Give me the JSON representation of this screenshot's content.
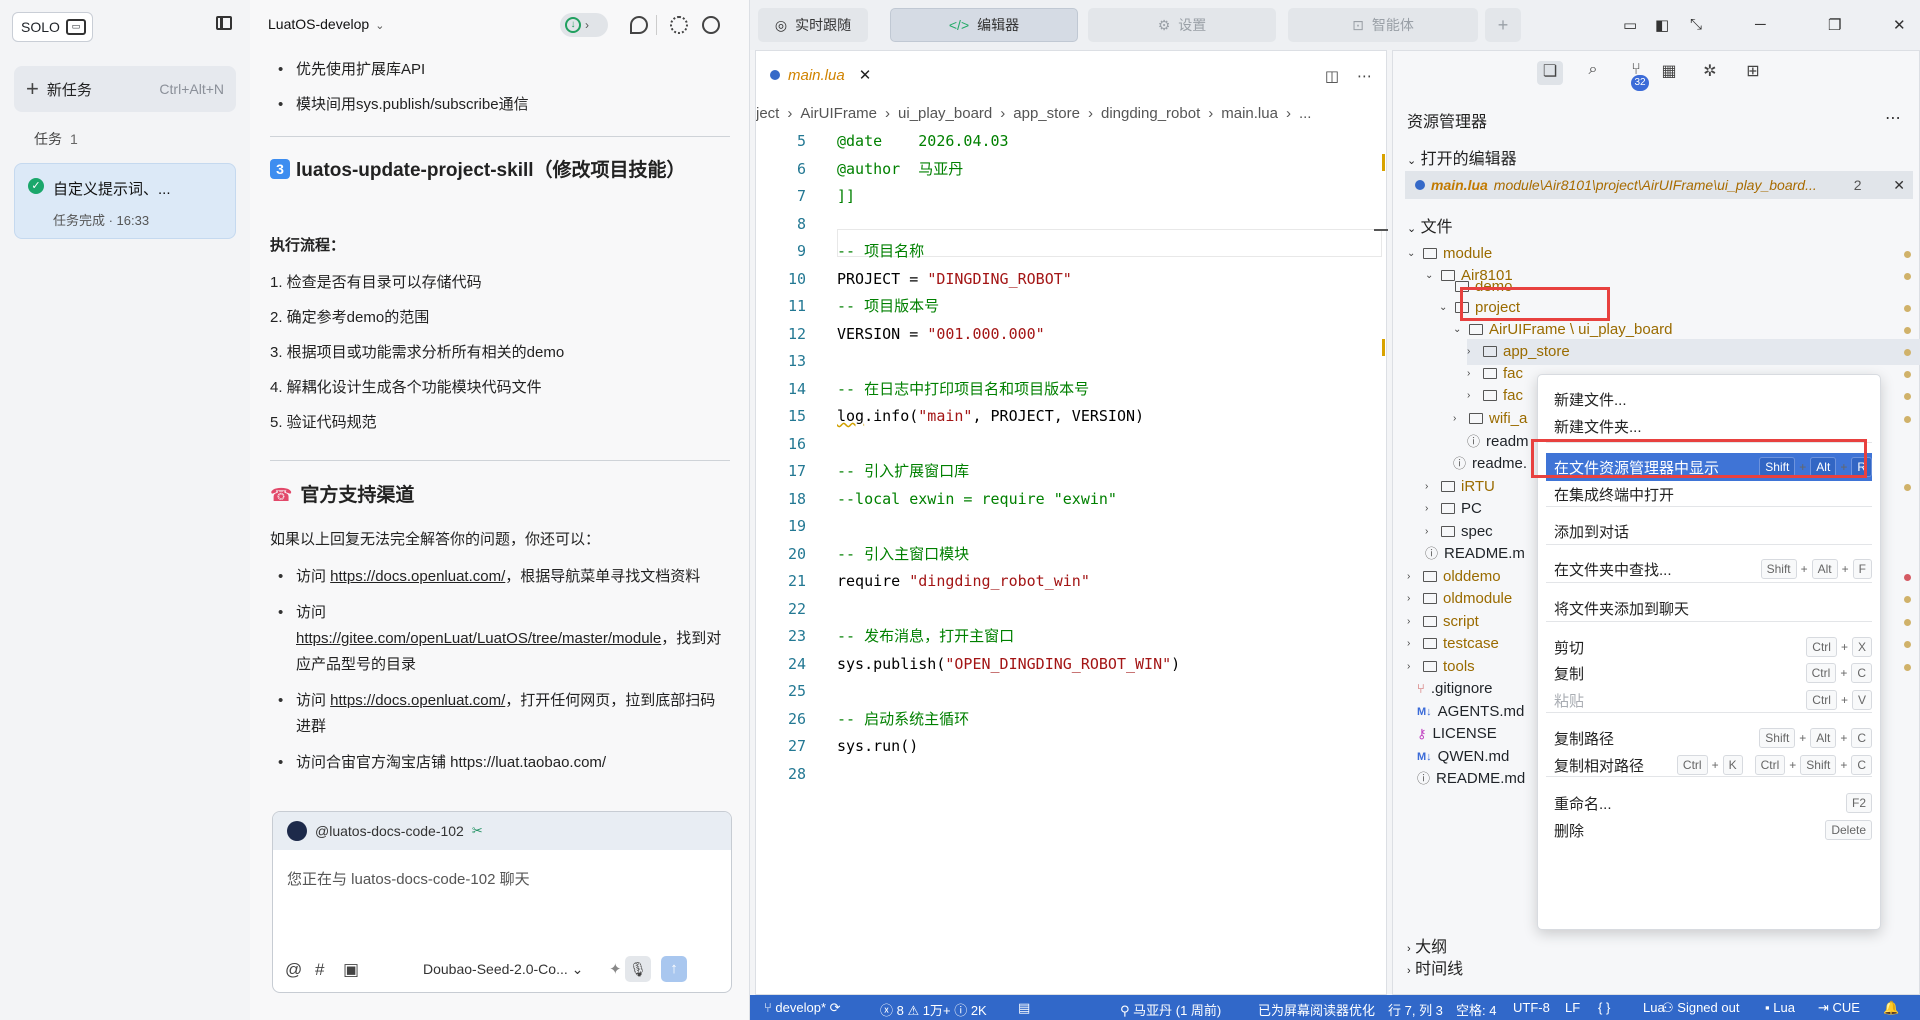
{
  "sidebar": {
    "solo": "SOLO",
    "new_task": "新任务",
    "new_task_kbd": "Ctrl+Alt+N",
    "tasks_label": "任务",
    "tasks_count": "1",
    "task_title": "自定义提示词、...",
    "task_status": "任务完成 · 16:33"
  },
  "chat": {
    "project": "LuatOS-develop",
    "bullets_top": [
      "优先使用扩展库API",
      "模块间用sys.publish/subscribe通信"
    ],
    "section3_num": "3",
    "section3_title": "luatos-update-project-skill（修改项目技能）",
    "flow_label": "执行流程：",
    "steps": [
      "1. 检查是否有目录可以存储代码",
      "2. 确定参考demo的范围",
      "3. 根据项目或功能需求分析所有相关的demo",
      "4. 解耦化设计生成各个功能模块代码文件",
      "5. 验证代码规范"
    ],
    "support_title": "官方支持渠道",
    "support_intro": "如果以上回复无法完全解答你的问题，你还可以：",
    "s1_pre": "访问 ",
    "s1_link": "https://docs.openluat.com/",
    "s1_post": "，根据导航菜单寻找文档资料",
    "s2_pre": "访问",
    "s2_link": "https://gitee.com/openLuat/LuatOS/tree/master/module",
    "s2_post": "，找到对应产品型号的目录",
    "s3_pre": "访问 ",
    "s3_link": "https://docs.openluat.com/",
    "s3_post": "，打开任何网页，拉到底部扫码进群",
    "s4": "访问合宙官方淘宝店铺 https://luat.taobao.com/",
    "mention": "@luatos-docs-code-102",
    "input_placeholder": "您正在与 luatos-docs-code-102 聊天",
    "model": "Doubao-Seed-2.0-Co..."
  },
  "top_tabs": {
    "t1": "实时跟随",
    "t2": "编辑器",
    "t3": "设置",
    "t4": "智能体"
  },
  "editor": {
    "tab": "main.lua",
    "breadcrumb": [
      "ject",
      "AirUIFrame",
      "ui_play_board",
      "app_store",
      "dingding_robot",
      "main.lua",
      "..."
    ],
    "lines": [
      {
        "n": "5",
        "t": "@date    2026.04.03",
        "c": "c-cmt"
      },
      {
        "n": "6",
        "t": "@author  马亚丹",
        "c": "c-cmt"
      },
      {
        "n": "7",
        "t": "]]",
        "c": "c-cmt"
      },
      {
        "n": "8",
        "t": "",
        "c": "c-def"
      },
      {
        "n": "9",
        "t": "-- 项目名称",
        "c": "c-cmt"
      },
      {
        "n": "10",
        "t": "PROJECT = \"DINGDING_ROBOT\"",
        "c": "mix1"
      },
      {
        "n": "11",
        "t": "-- 项目版本号",
        "c": "c-cmt"
      },
      {
        "n": "12",
        "t": "VERSION = \"001.000.000\"",
        "c": "mix2"
      },
      {
        "n": "13",
        "t": "",
        "c": "c-def"
      },
      {
        "n": "14",
        "t": "-- 在日志中打印项目名和项目版本号",
        "c": "c-cmt"
      },
      {
        "n": "15",
        "t": "log.info(\"main\", PROJECT, VERSION)",
        "c": "mix3"
      },
      {
        "n": "16",
        "t": "",
        "c": "c-def"
      },
      {
        "n": "17",
        "t": "-- 引入扩展窗口库",
        "c": "c-cmt"
      },
      {
        "n": "18",
        "t": "--local exwin = require \"exwin\"",
        "c": "c-cmt"
      },
      {
        "n": "19",
        "t": "",
        "c": "c-def"
      },
      {
        "n": "20",
        "t": "-- 引入主窗口模块",
        "c": "c-cmt"
      },
      {
        "n": "21",
        "t": "require \"dingding_robot_win\"",
        "c": "mix4"
      },
      {
        "n": "22",
        "t": "",
        "c": "c-def"
      },
      {
        "n": "23",
        "t": "-- 发布消息，打开主窗口",
        "c": "c-cmt"
      },
      {
        "n": "24",
        "t": "sys.publish(\"OPEN_DINGDING_ROBOT_WIN\")",
        "c": "mix5"
      },
      {
        "n": "25",
        "t": "",
        "c": "c-def"
      },
      {
        "n": "26",
        "t": "-- 启动系统主循环",
        "c": "c-cmt"
      },
      {
        "n": "27",
        "t": "sys.run()",
        "c": "c-def"
      },
      {
        "n": "28",
        "t": "",
        "c": "c-def"
      }
    ]
  },
  "explorer": {
    "title": "资源管理器",
    "open_editors": "打开的编辑器",
    "open_file": "main.lua",
    "open_path": "module\\Air8101\\project\\AirUIFrame\\ui_play_board...",
    "open_count": "2",
    "files_label": "文件",
    "git_badge": "32",
    "items": [
      {
        "label": "module",
        "cls": "mod"
      },
      {
        "label": "Air8101",
        "cls": "mod"
      },
      {
        "label": "demo",
        "cls": "mod"
      },
      {
        "label": "project",
        "cls": "mod"
      },
      {
        "label": "AirUIFrame \\ ui_play_board",
        "cls": "mod"
      },
      {
        "label": "app_store",
        "cls": "mod"
      },
      {
        "label": "fac",
        "cls": "mod"
      },
      {
        "label": "fac",
        "cls": "mod"
      },
      {
        "label": "wifi_a",
        "cls": "mod"
      },
      {
        "label": "readm",
        "cls": ""
      },
      {
        "label": "readme.",
        "cls": ""
      },
      {
        "label": "iRTU",
        "cls": "mod"
      },
      {
        "label": "PC",
        "cls": ""
      },
      {
        "label": "spec",
        "cls": ""
      },
      {
        "label": "README.m",
        "cls": ""
      },
      {
        "label": "olddemo",
        "cls": "mod"
      },
      {
        "label": "oldmodule",
        "cls": "mod"
      },
      {
        "label": "script",
        "cls": "mod"
      },
      {
        "label": "testcase",
        "cls": "mod"
      },
      {
        "label": "tools",
        "cls": "mod"
      },
      {
        "label": ".gitignore",
        "cls": ""
      },
      {
        "label": "AGENTS.md",
        "cls": ""
      },
      {
        "label": "LICENSE",
        "cls": ""
      },
      {
        "label": "QWEN.md",
        "cls": ""
      },
      {
        "label": "README.md",
        "cls": ""
      }
    ],
    "outline": "大纲",
    "timeline": "时间线"
  },
  "context_menu": {
    "items": [
      {
        "label": "新建文件...",
        "keys": []
      },
      {
        "label": "新建文件夹...",
        "keys": []
      },
      {
        "label": "在文件资源管理器中显示",
        "keys": [
          "Shift",
          "Alt",
          "R"
        ]
      },
      {
        "label": "在集成终端中打开",
        "keys": []
      },
      {
        "label": "添加到对话",
        "keys": []
      },
      {
        "label": "在文件夹中查找...",
        "keys": [
          "Shift",
          "Alt",
          "F"
        ]
      },
      {
        "label": "将文件夹添加到聊天",
        "keys": []
      },
      {
        "label": "剪切",
        "keys": [
          "Ctrl",
          "X"
        ]
      },
      {
        "label": "复制",
        "keys": [
          "Ctrl",
          "C"
        ]
      },
      {
        "label": "粘贴",
        "keys": [
          "Ctrl",
          "V"
        ]
      },
      {
        "label": "复制路径",
        "keys": [
          "Shift",
          "Alt",
          "C"
        ]
      },
      {
        "label": "复制相对路径",
        "keys": [
          "Ctrl",
          "K",
          "Ctrl",
          "Shift",
          "C"
        ]
      },
      {
        "label": "重命名...",
        "keys": [
          "F2"
        ]
      },
      {
        "label": "删除",
        "keys": [
          "Delete"
        ]
      }
    ]
  },
  "status": {
    "branch": "develop*",
    "errors": "8",
    "warnings": "1万+",
    "infos": "2K",
    "author": "马亚丹 (1 周前)",
    "a11y": "已为屏幕阅读器优化",
    "pos": "行 7, 列 3",
    "spaces": "空格: 4",
    "enc": "UTF-8",
    "eol": "LF",
    "braces": "{ }",
    "lang": "Lua",
    "signed": "Signed out",
    "lua2": "Lua",
    "cue": "CUE"
  }
}
